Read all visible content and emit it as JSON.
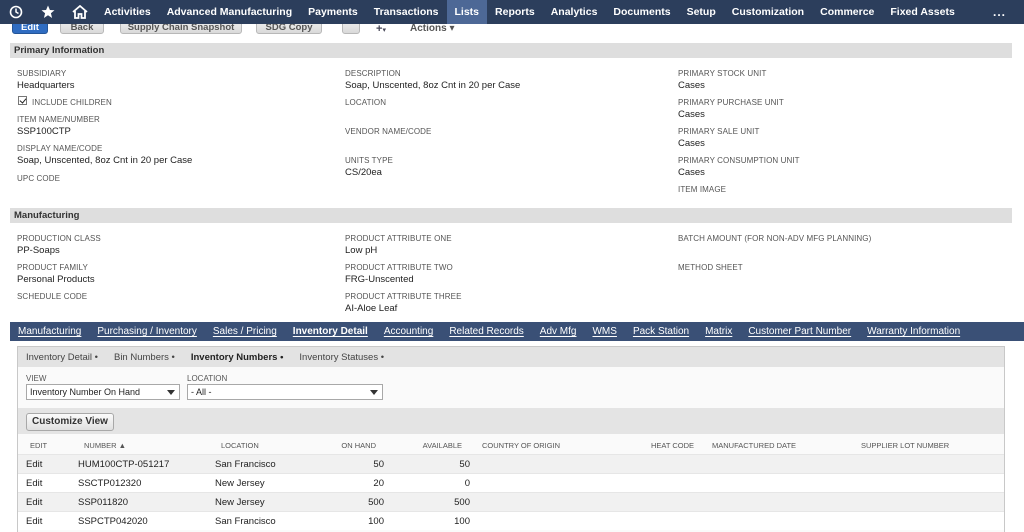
{
  "nav": {
    "icons": [
      "history-icon",
      "star-icon",
      "home-icon"
    ],
    "items": [
      {
        "label": "Activities",
        "active": false
      },
      {
        "label": "Advanced Manufacturing",
        "active": false
      },
      {
        "label": "Payments",
        "active": false
      },
      {
        "label": "Transactions",
        "active": false
      },
      {
        "label": "Lists",
        "active": true
      },
      {
        "label": "Reports",
        "active": false
      },
      {
        "label": "Analytics",
        "active": false
      },
      {
        "label": "Documents",
        "active": false
      },
      {
        "label": "Setup",
        "active": false
      },
      {
        "label": "Customization",
        "active": false
      },
      {
        "label": "Commerce",
        "active": false
      },
      {
        "label": "Fixed Assets",
        "active": false
      }
    ],
    "more": "..."
  },
  "toolbar": {
    "edit_label": "Edit",
    "back_label": "Back",
    "supply_chain_label": "Supply Chain Snapshot",
    "sdg_copy_label": "SDG Copy",
    "actions_label": "Actions"
  },
  "primary": {
    "header": "Primary Information",
    "subsidiary_label": "SUBSIDIARY",
    "subsidiary_value": "Headquarters",
    "include_children_label": "INCLUDE CHILDREN",
    "item_name_label": "ITEM NAME/NUMBER",
    "item_name_value": "SSP100CTP",
    "display_name_label": "DISPLAY NAME/CODE",
    "display_name_value": "Soap, Unscented, 8oz Cnt in 20 per Case",
    "upc_label": "UPC CODE",
    "description_label": "DESCRIPTION",
    "description_value": "Soap, Unscented, 8oz Cnt in 20 per Case",
    "location_label": "LOCATION",
    "vendor_label": "VENDOR NAME/CODE",
    "units_type_label": "UNITS TYPE",
    "units_type_value": "CS/20ea",
    "stock_unit_label": "PRIMARY STOCK UNIT",
    "stock_unit_value": "Cases",
    "purchase_unit_label": "PRIMARY PURCHASE UNIT",
    "purchase_unit_value": "Cases",
    "sale_unit_label": "PRIMARY SALE UNIT",
    "sale_unit_value": "Cases",
    "consumption_unit_label": "PRIMARY CONSUMPTION UNIT",
    "consumption_unit_value": "Cases",
    "item_image_label": "ITEM IMAGE"
  },
  "manufacturing": {
    "header": "Manufacturing",
    "production_class_label": "PRODUCTION CLASS",
    "production_class_value": "PP-Soaps",
    "product_family_label": "PRODUCT FAMILY",
    "product_family_value": "Personal Products",
    "schedule_code_label": "SCHEDULE CODE",
    "attr_one_label": "PRODUCT ATTRIBUTE ONE",
    "attr_one_value": "Low pH",
    "attr_two_label": "PRODUCT ATTRIBUTE TWO",
    "attr_two_value": "FRG-Unscented",
    "attr_three_label": "PRODUCT ATTRIBUTE THREE",
    "attr_three_value": "AI-Aloe Leaf",
    "batch_amount_label": "BATCH AMOUNT (FOR NON-ADV MFG PLANNING)",
    "method_sheet_label": "METHOD SHEET"
  },
  "subtabs": [
    {
      "label": "Manufacturing",
      "active": false
    },
    {
      "label": "Purchasing / Inventory",
      "active": false
    },
    {
      "label": "Sales / Pricing",
      "active": false
    },
    {
      "label": "Inventory Detail",
      "active": true
    },
    {
      "label": "Accounting",
      "active": false
    },
    {
      "label": "Related Records",
      "active": false
    },
    {
      "label": "Adv Mfg",
      "active": false
    },
    {
      "label": "WMS",
      "active": false
    },
    {
      "label": "Pack Station",
      "active": false
    },
    {
      "label": "Matrix",
      "active": false
    },
    {
      "label": "Customer Part Number",
      "active": false
    },
    {
      "label": "Warranty Information",
      "active": false
    }
  ],
  "inner_tabs": [
    {
      "label": "Inventory Detail •",
      "active": false
    },
    {
      "label": "Bin Numbers •",
      "active": false
    },
    {
      "label": "Inventory Numbers •",
      "active": true
    },
    {
      "label": "Inventory Statuses •",
      "active": false
    }
  ],
  "filters": {
    "view_label": "VIEW",
    "view_value": "Inventory Number On Hand",
    "location_label": "LOCATION",
    "location_value": "- All -"
  },
  "customize_view_label": "Customize View",
  "table": {
    "headers": {
      "edit": "EDIT",
      "number": "NUMBER ▲",
      "location": "LOCATION",
      "on_hand": "ON HAND",
      "available": "AVAILABLE",
      "country": "COUNTRY OF ORIGIN",
      "heat_code": "HEAT CODE",
      "manufactured_date": "MANUFACTURED DATE",
      "supplier_lot": "SUPPLIER LOT NUMBER"
    },
    "rows": [
      {
        "edit": "Edit",
        "number": "HUM100CTP-051217",
        "location": "San Francisco",
        "on_hand": "50",
        "available": "50"
      },
      {
        "edit": "Edit",
        "number": "SSCTP012320",
        "location": "New Jersey",
        "on_hand": "20",
        "available": "0"
      },
      {
        "edit": "Edit",
        "number": "SSP011820",
        "location": "New Jersey",
        "on_hand": "500",
        "available": "500"
      },
      {
        "edit": "Edit",
        "number": "SSPCTP042020",
        "location": "San Francisco",
        "on_hand": "100",
        "available": "100"
      }
    ]
  }
}
